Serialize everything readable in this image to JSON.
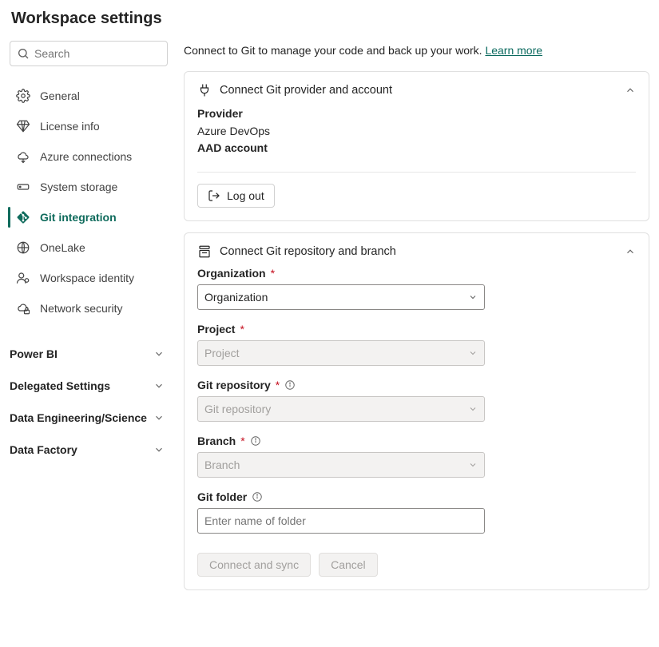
{
  "page_title": "Workspace settings",
  "search": {
    "placeholder": "Search"
  },
  "sidebar": {
    "items": [
      {
        "label": "General"
      },
      {
        "label": "License info"
      },
      {
        "label": "Azure connections"
      },
      {
        "label": "System storage"
      },
      {
        "label": "Git integration"
      },
      {
        "label": "OneLake"
      },
      {
        "label": "Workspace identity"
      },
      {
        "label": "Network security"
      }
    ],
    "sections": [
      {
        "label": "Power BI"
      },
      {
        "label": "Delegated Settings"
      },
      {
        "label": "Data Engineering/Science"
      },
      {
        "label": "Data Factory"
      }
    ]
  },
  "intro": {
    "text": "Connect to Git to manage your code and back up your work. ",
    "link": "Learn more"
  },
  "card_provider": {
    "title": "Connect Git provider and account",
    "provider_label": "Provider",
    "provider_value": "Azure DevOps",
    "aad_label": "AAD account",
    "logout": "Log out"
  },
  "card_repo": {
    "title": "Connect Git repository and branch",
    "org_label": "Organization",
    "org_value": "Organization",
    "project_label": "Project",
    "project_placeholder": "Project",
    "repo_label": "Git repository",
    "repo_placeholder": "Git repository",
    "branch_label": "Branch",
    "branch_placeholder": "Branch",
    "folder_label": "Git folder",
    "folder_placeholder": "Enter name of folder",
    "connect_btn": "Connect and sync",
    "cancel_btn": "Cancel"
  }
}
